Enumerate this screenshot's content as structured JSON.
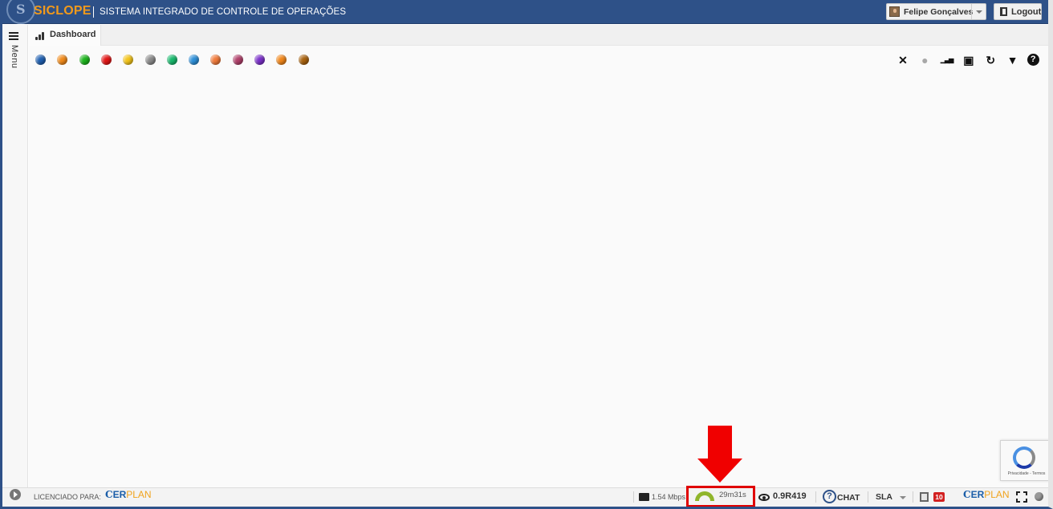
{
  "header": {
    "brand": "SICLOPE",
    "subtitle": "SISTEMA INTEGRADO DE CONTROLE DE OPERAÇÕES",
    "user_name": "Felipe Gonçalves",
    "logout_label": "Logout"
  },
  "sidebar": {
    "menu_label": "Menu"
  },
  "tabs": [
    {
      "label": "Dashboard",
      "icon": "bar-chart-icon"
    }
  ],
  "status_dots": [
    {
      "color": "#1f5fb0",
      "icon": "blue-ball-icon"
    },
    {
      "color": "#f08a1a",
      "icon": "orange-ball-icon"
    },
    {
      "color": "#1db41d",
      "icon": "green-ball-icon"
    },
    {
      "color": "#e21616",
      "icon": "red-ball-icon"
    },
    {
      "color": "#f3c41a",
      "icon": "yellow-ball-icon"
    },
    {
      "color": "#8a8a8a",
      "icon": "gray-ball-icon"
    },
    {
      "color": "#18b86c",
      "icon": "emerald-ball-icon"
    },
    {
      "color": "#2d8fd8",
      "icon": "light-blue-ball-icon"
    },
    {
      "color": "#f07a3a",
      "icon": "coral-ball-icon"
    },
    {
      "color": "#b0406a",
      "icon": "rose-ball-icon"
    },
    {
      "color": "#7a30c8",
      "icon": "purple-ball-icon"
    },
    {
      "color": "#f0861a",
      "icon": "amber-ball-icon"
    },
    {
      "color": "#a8620e",
      "icon": "brown-ball-icon"
    }
  ],
  "toolbar": [
    {
      "icon": "close-icon",
      "glyph": "✕"
    },
    {
      "icon": "status-ball-icon",
      "glyph": "●"
    },
    {
      "icon": "signal-bars-icon",
      "glyph": "▁▃▅"
    },
    {
      "icon": "monitor-icon",
      "glyph": "▣"
    },
    {
      "icon": "refresh-icon",
      "glyph": "↻"
    },
    {
      "icon": "filter-icon",
      "glyph": "▼"
    },
    {
      "icon": "help-icon",
      "glyph": "?"
    }
  ],
  "footer": {
    "licensed_label": "LICENCIADO PARA:",
    "licensee_er": "ER",
    "licensee_plan": "PLAN",
    "bandwidth": "1.54 Mbps",
    "timer": "29m31s",
    "version": "0.9R419",
    "chat_label": "CHAT",
    "chat_glyph": "?",
    "sla_label": "SLA",
    "notification_count": "10"
  },
  "recaptcha": {
    "text": "Privacidade - Termos"
  },
  "colors": {
    "header_bg": "#2e5188",
    "brand": "#f29a1b",
    "annotation_red": "#f00000",
    "timer_gauge": "#8fb52b"
  }
}
